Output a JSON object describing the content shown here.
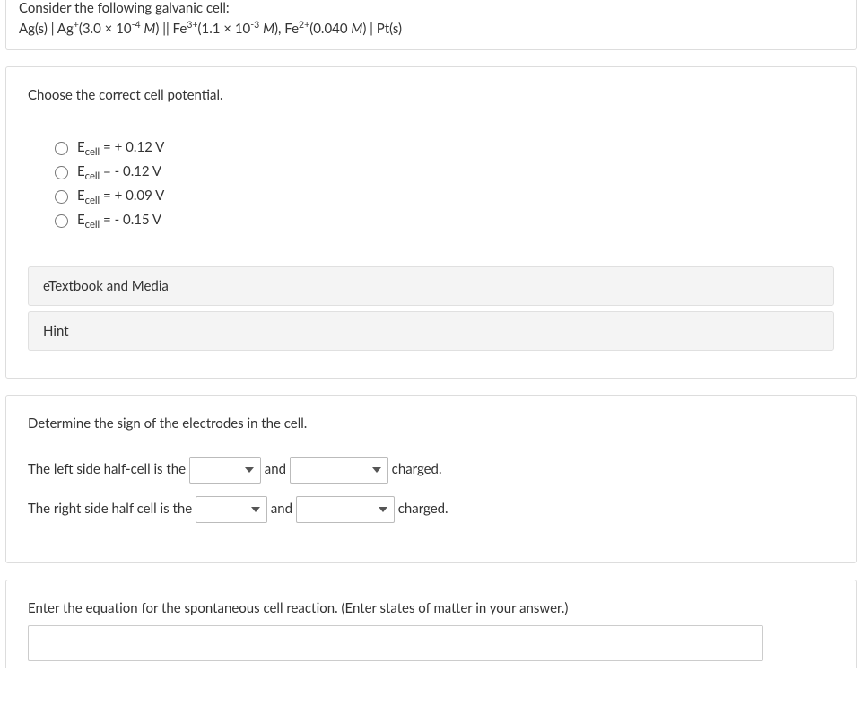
{
  "intro": {
    "line1": "Consider the following galvanic cell:",
    "cell_html": "Ag(s) | Ag<sup>+</sup>(3.0 × 10<sup>-4</sup> <span class='italic'>M</span>) || Fe<sup>3+</sup>(1.1 × 10<sup>-3</sup> <span class='italic'>M</span>), Fe<sup>2+</sup>(0.040 <span class='italic'>M</span>) | Pt(s)"
  },
  "q1": {
    "prompt": "Choose the correct cell potential.",
    "options": [
      "E<sub>cell</sub> = + 0.12 V",
      "E<sub>cell</sub> = - 0.12 V",
      "E<sub>cell</sub> = + 0.09 V",
      "E<sub>cell</sub> = - 0.15 V"
    ],
    "btn_etext": "eTextbook and Media",
    "btn_hint": "Hint"
  },
  "q2": {
    "prompt": "Determine the sign of the electrodes in the cell.",
    "row1_pre": "The left side half-cell is the",
    "row1_mid": "and",
    "row1_post": "charged.",
    "row2_pre": "The right side half cell is the",
    "row2_mid": "and",
    "row2_post": "charged.",
    "blank": ""
  },
  "q3": {
    "prompt": "Enter the equation for the spontaneous cell reaction. (Enter states of matter in your answer.)"
  }
}
